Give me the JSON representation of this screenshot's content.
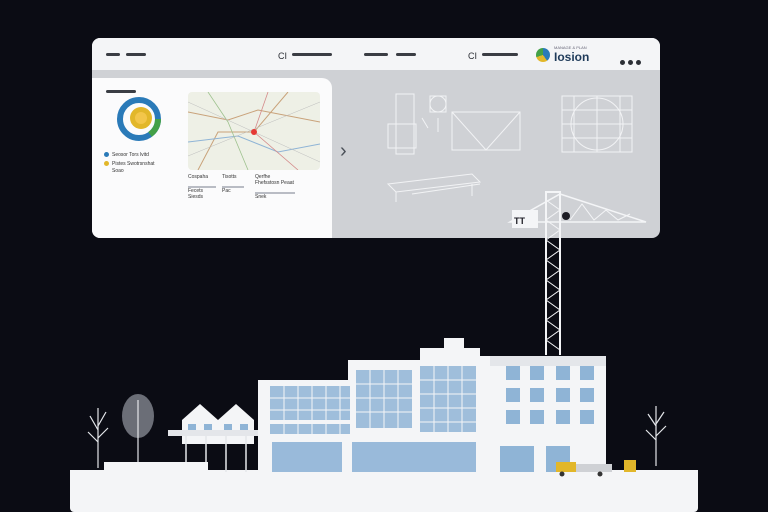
{
  "header": {
    "left_text": "CI",
    "mid_text": "CI",
    "brand_tag": "MANAGE & PLAN",
    "brand_name": "Iosion"
  },
  "card": {
    "legend": [
      {
        "label": "Seosor Tors lvitd",
        "color": "#2a7ab8"
      },
      {
        "label": "Pistes Swotrsnshat",
        "color": "#e2b72a"
      },
      {
        "label": "Soao",
        "color": "#b9bcc4"
      }
    ],
    "columns": [
      {
        "title": "Cospaha",
        "rows": [
          "Fecets",
          "Siesds"
        ]
      },
      {
        "title": "Tisotts",
        "rows": [
          "Pac"
        ]
      },
      {
        "title": "Qerfhe",
        "rows": [
          "Fhefsstosn Peaat",
          "Snek"
        ]
      }
    ]
  },
  "crane": {
    "label": "TT"
  },
  "colors": {
    "background": "#0b0c14",
    "panel": "#cfd1d5",
    "card": "#fbfbfc",
    "accent_blue": "#2a7ab8",
    "accent_yellow": "#e2b72a"
  }
}
